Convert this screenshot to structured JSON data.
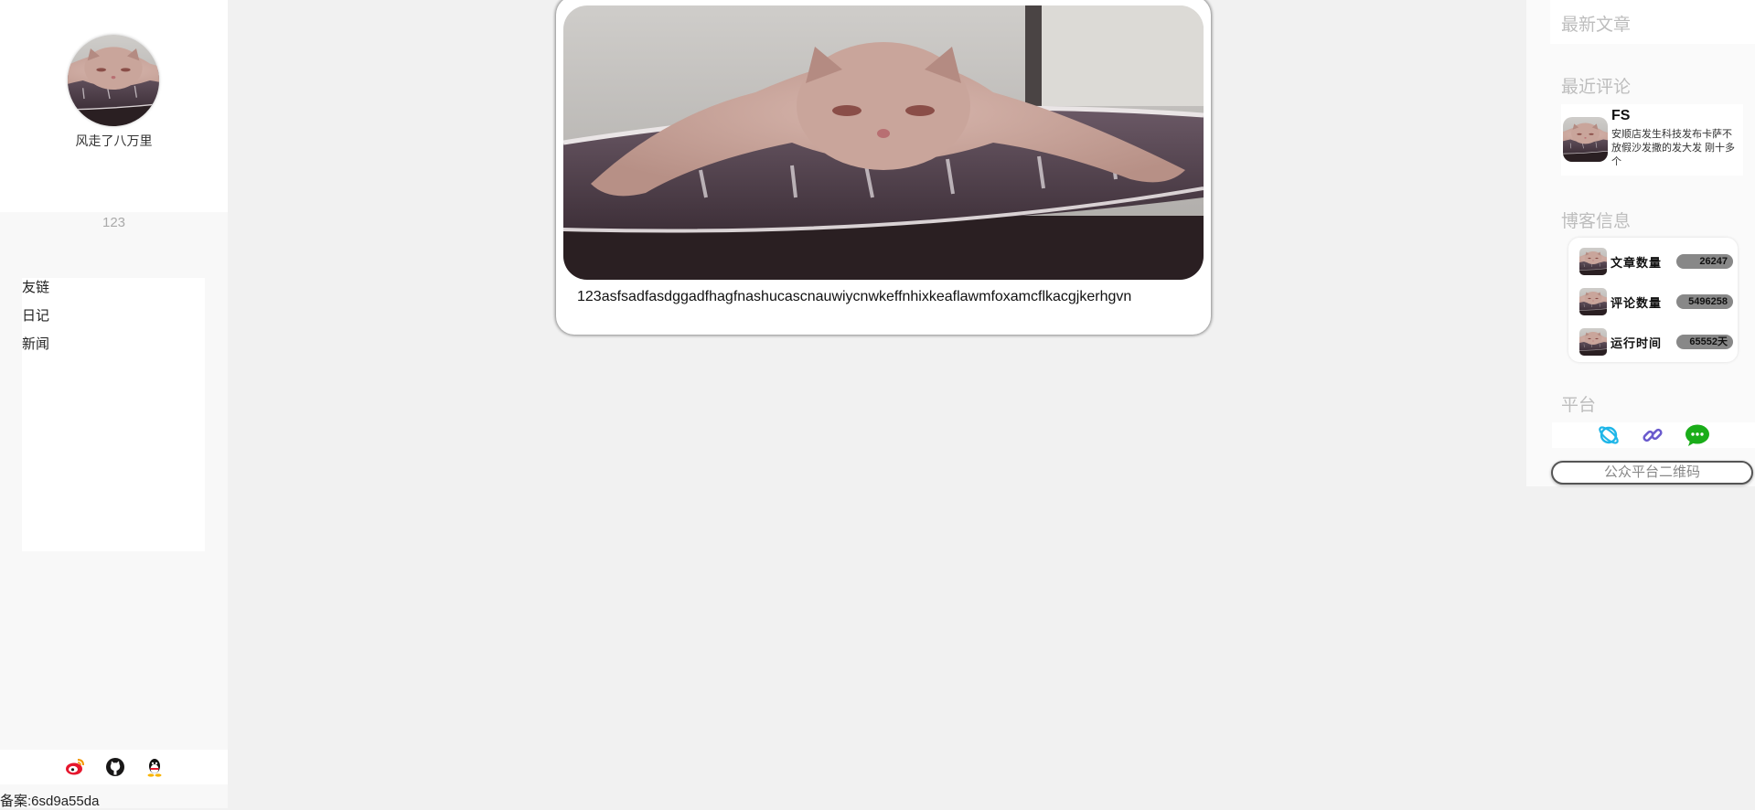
{
  "left_sidebar": {
    "author_name": "风走了八万里",
    "tagline": "123",
    "nav": [
      "友链",
      "日记",
      "新闻"
    ],
    "socials": [
      "weibo-icon",
      "github-icon",
      "qq-icon"
    ],
    "beian": "备案:6sd9a55da"
  },
  "post": {
    "title": "123asfsadfasdggadfhagfnashucascnauwiycnwkeffnhixkeaflawmfoxamcflkacgjkerhgvn"
  },
  "right_sidebar": {
    "latest_articles_title": "最新文章",
    "recent_comments_title": "最近评论",
    "comment": {
      "user": "FS",
      "text": "安顺店发生科技发布卡萨不放假沙发撒的发大发 刚十多个"
    },
    "blog_info_title": "博客信息",
    "blog_info": [
      {
        "label": "文章数量",
        "value": "26247"
      },
      {
        "label": "评论数量",
        "value": "5496258"
      },
      {
        "label": "运行时间",
        "value": "65552天"
      }
    ],
    "platform_title": "平台",
    "platforms": [
      "planet-icon",
      "link-icon",
      "wechat-icon"
    ],
    "qr_button": "公众平台二维码"
  },
  "colors": {
    "background": "#f1f1f1",
    "section_title": "#bdbdbd",
    "badge": "#888888",
    "weibo": "#e6162d",
    "wechat": "#1aad19",
    "link": "#6a5acd",
    "planet": "#1fb6e8"
  }
}
